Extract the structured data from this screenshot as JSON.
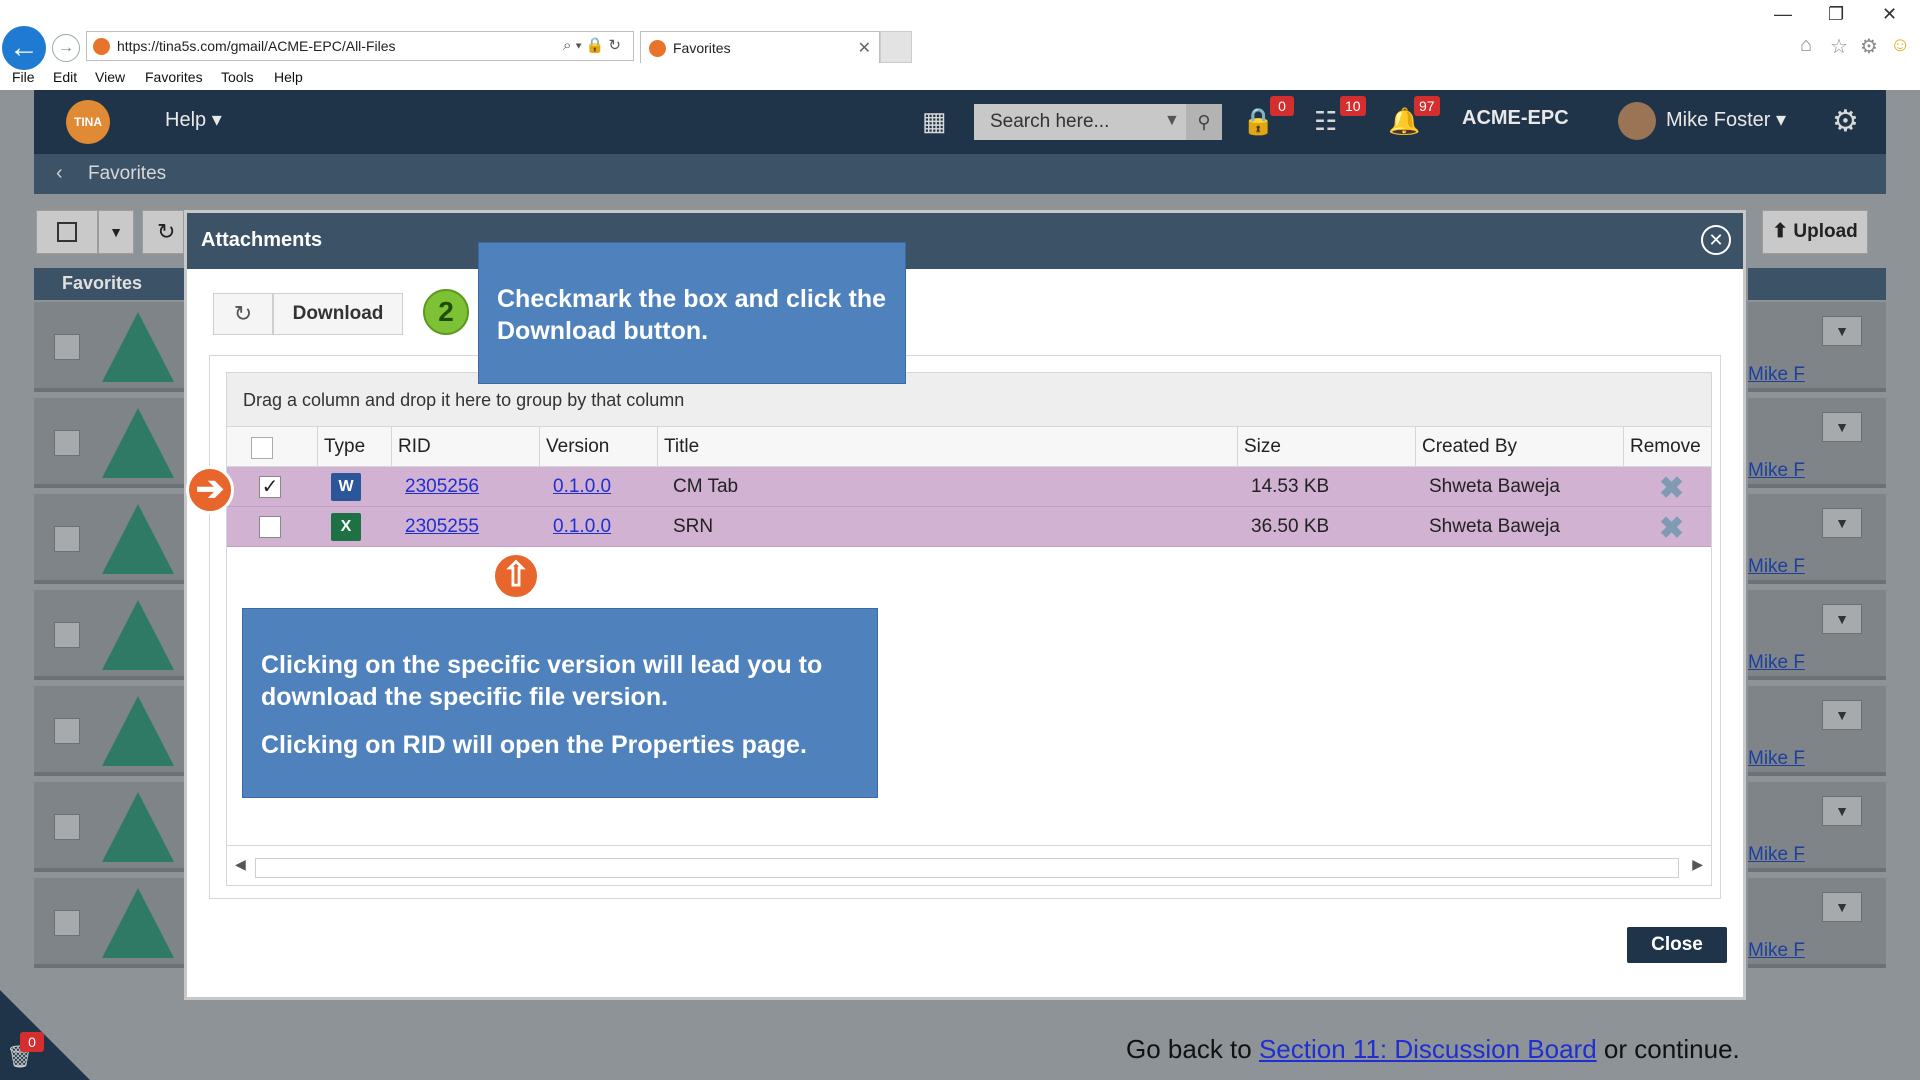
{
  "browser": {
    "url": "https://tina5s.com/gmail/ACME-EPC/All-Files",
    "tab_title": "Favorites",
    "menu": [
      "File",
      "Edit",
      "View",
      "Favorites",
      "Tools",
      "Help"
    ]
  },
  "app": {
    "logo_text": "TINA",
    "help_label": "Help",
    "search_placeholder": "Search here...",
    "badges": {
      "lock": "0",
      "hierarchy": "10",
      "bell": "97",
      "trash": "0"
    },
    "org": "ACME-EPC",
    "user": "Mike Foster",
    "breadcrumb": "Favorites",
    "upload_label": "Upload",
    "sidebar_title": "Favorites",
    "bg_link_text": "Mike F"
  },
  "modal": {
    "title": "Attachments",
    "download_label": "Download",
    "step": "2",
    "group_hint": "Drag a column and drop it here to group by that column",
    "columns": [
      "Type",
      "RID",
      "Version",
      "Title",
      "Size",
      "Created By",
      "Remove"
    ],
    "rows": [
      {
        "checked": true,
        "type": "word",
        "type_letter": "W",
        "rid": "2305256",
        "version": "0.1.0.0",
        "title": "CM Tab",
        "size": "14.53 KB",
        "created_by": "Shweta Baweja"
      },
      {
        "checked": false,
        "type": "excel",
        "type_letter": "X",
        "rid": "2305255",
        "version": "0.1.0.0",
        "title": "SRN",
        "size": "36.50 KB",
        "created_by": "Shweta Baweja"
      }
    ],
    "close_label": "Close"
  },
  "callouts": {
    "c1": "Checkmark the box and click the Download button.",
    "c2_line1": "Clicking on the specific version will lead you to download the specific file version.",
    "c2_line2": "Clicking on RID will open the Properties page."
  },
  "footer": {
    "prefix": "Go back to ",
    "link": "Section 11: Discussion Board",
    "suffix": " or continue."
  },
  "colors": {
    "header": "#1f3448",
    "row_highlight": "#d1b2d3",
    "callout": "#4f81bd",
    "arrow": "#e8652b",
    "step": "#7cc234"
  }
}
